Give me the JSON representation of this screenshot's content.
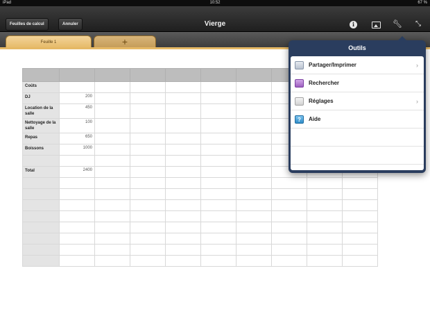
{
  "status_bar": {
    "left": "iPad",
    "time": "10:52",
    "right": "67 %"
  },
  "toolbar": {
    "spreadsheets_label": "Feuilles de calcul",
    "undo_label": "Annuler",
    "title": "Vierge",
    "icons": [
      "info-icon",
      "media-icon",
      "wrench-icon",
      "fullscreen-icon"
    ]
  },
  "tabs": [
    {
      "label": "Feuille 1",
      "active": true
    },
    {
      "label": "+",
      "active": false
    }
  ],
  "sheet": {
    "rows": [
      {
        "label": "Coûts",
        "value": ""
      },
      {
        "label": "DJ",
        "value": "200"
      },
      {
        "label": "Location de la salle",
        "value": "450"
      },
      {
        "label": "Nettoyage de la salle",
        "value": "100"
      },
      {
        "label": "Repas",
        "value": "650"
      },
      {
        "label": "Boissons",
        "value": "1000"
      },
      {
        "label": "",
        "value": ""
      },
      {
        "label": "Total",
        "value": "2400"
      }
    ]
  },
  "tools_menu": {
    "title": "Outils",
    "items": [
      {
        "label": "Partager/Imprimer",
        "icon": "share-print-icon",
        "chevron": true
      },
      {
        "label": "Rechercher",
        "icon": "search-icon",
        "chevron": false
      },
      {
        "label": "Réglages",
        "icon": "settings-icon",
        "chevron": true
      },
      {
        "label": "Aide",
        "icon": "help-icon",
        "chevron": false
      }
    ]
  },
  "colors": {
    "toolbar": "#2a2a2a",
    "tab_active": "#e5b865",
    "popover_frame": "#2a3d5e",
    "header_row": "#bdbdbd",
    "label_column": "#e4e4e4"
  }
}
